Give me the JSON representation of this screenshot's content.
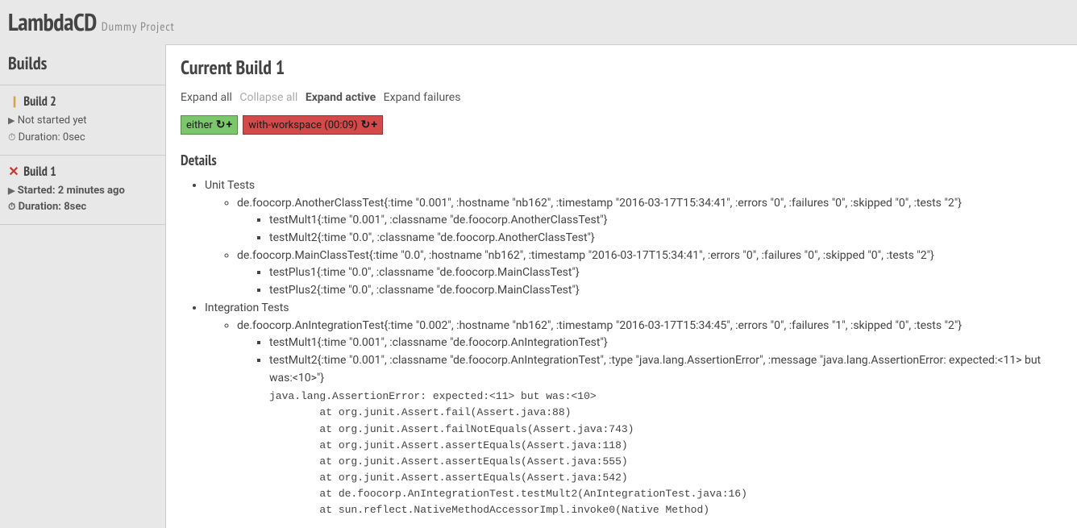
{
  "header": {
    "title": "LambdaCD",
    "subtitle": "Dummy Project"
  },
  "sidebar": {
    "title": "Builds",
    "builds": [
      {
        "name": "Build 2",
        "status_icon": "paused",
        "started": "Not started yet",
        "duration": "Duration: 0sec",
        "active": false
      },
      {
        "name": "Build 1",
        "status_icon": "failed",
        "started": "Started: 2 minutes ago",
        "duration": "Duration: 8sec",
        "active": true
      }
    ]
  },
  "main": {
    "title": "Current Build 1",
    "expand": {
      "all": "Expand all",
      "collapse": "Collapse all",
      "active": "Expand active",
      "failures": "Expand failures"
    },
    "steps": [
      {
        "label": "either",
        "color": "green",
        "duration": ""
      },
      {
        "label": "with-workspace",
        "color": "red",
        "duration": "(00:09)"
      }
    ],
    "details_title": "Details",
    "suites": [
      {
        "name": "Unit Tests",
        "classes": [
          {
            "summary": "de.foocorp.AnotherClassTest{:time \"0.001\", :hostname \"nb162\", :timestamp \"2016-03-17T15:34:41\", :errors \"0\", :failures \"0\", :skipped \"0\", :tests \"2\"}",
            "tests": [
              "testMult1{:time \"0.001\", :classname \"de.foocorp.AnotherClassTest\"}",
              "testMult2{:time \"0.0\", :classname \"de.foocorp.AnotherClassTest\"}"
            ]
          },
          {
            "summary": "de.foocorp.MainClassTest{:time \"0.0\", :hostname \"nb162\", :timestamp \"2016-03-17T15:34:41\", :errors \"0\", :failures \"0\", :skipped \"0\", :tests \"2\"}",
            "tests": [
              "testPlus1{:time \"0.0\", :classname \"de.foocorp.MainClassTest\"}",
              "testPlus2{:time \"0.0\", :classname \"de.foocorp.MainClassTest\"}"
            ]
          }
        ]
      },
      {
        "name": "Integration Tests",
        "classes": [
          {
            "summary": "de.foocorp.AnIntegrationTest{:time \"0.002\", :hostname \"nb162\", :timestamp \"2016-03-17T15:34:45\", :errors \"0\", :failures \"1\", :skipped \"0\", :tests \"2\"}",
            "tests": [
              "testMult1{:time \"0.001\", :classname \"de.foocorp.AnIntegrationTest\"}",
              "testMult2{:time \"0.001\", :classname \"de.foocorp.AnIntegrationTest\", :type \"java.lang.AssertionError\", :message \"java.lang.AssertionError: expected:<11> but was:<10>\"}"
            ],
            "stack": "java.lang.AssertionError: expected:<11> but was:<10>\n        at org.junit.Assert.fail(Assert.java:88)\n        at org.junit.Assert.failNotEquals(Assert.java:743)\n        at org.junit.Assert.assertEquals(Assert.java:118)\n        at org.junit.Assert.assertEquals(Assert.java:555)\n        at org.junit.Assert.assertEquals(Assert.java:542)\n        at de.foocorp.AnIntegrationTest.testMult2(AnIntegrationTest.java:16)\n        at sun.reflect.NativeMethodAccessorImpl.invoke0(Native Method)"
          }
        ]
      }
    ]
  }
}
